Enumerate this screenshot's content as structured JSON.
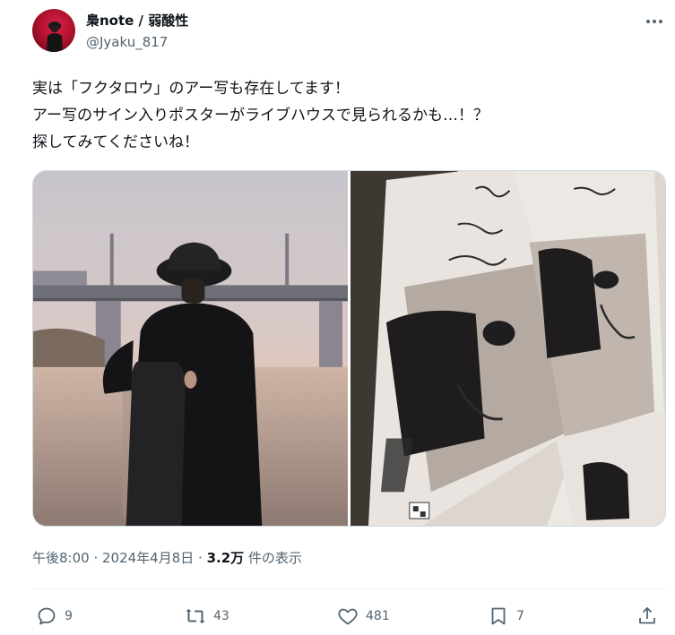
{
  "author": {
    "display_name": "梟note / 弱酸性",
    "handle": "@Jyaku_817",
    "avatar_icon": "user-avatar"
  },
  "more_icon": "more-horizontal-icon",
  "tweet": {
    "lines": [
      "実は「フクタロウ」のアー写も存在してます！",
      "アー写のサイン入りポスターがライブハウスで見られるかも…！？",
      "探してみてくださいね！"
    ]
  },
  "media": {
    "photos": [
      {
        "icon": "photo-man-with-guitar-case"
      },
      {
        "icon": "photo-signed-posters"
      }
    ]
  },
  "meta": {
    "time": "午後8:00",
    "sep1": " · ",
    "date": "2024年4月8日",
    "sep2": " · ",
    "views_count": "3.2万",
    "views_label": " 件の表示"
  },
  "actions": {
    "reply_count": "9",
    "retweet_count": "43",
    "like_count": "481",
    "bookmark_count": "7"
  },
  "colors": {
    "text_primary": "#0f1419",
    "text_secondary": "#536471",
    "border": "#cfd9de",
    "divider": "#eff3f4"
  }
}
